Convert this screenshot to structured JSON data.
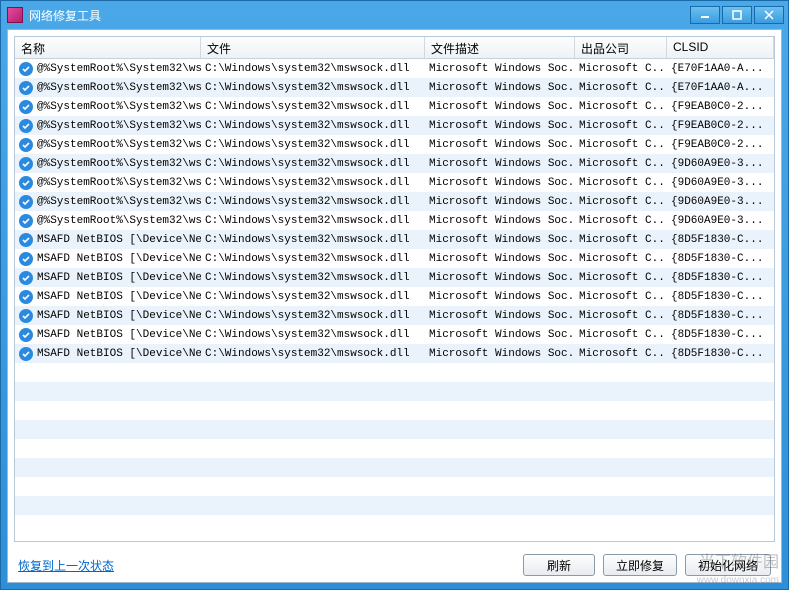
{
  "window": {
    "title": "网络修复工具"
  },
  "columns": {
    "name": "名称",
    "file": "文件",
    "desc": "文件描述",
    "company": "出品公司",
    "clsid": "CLSID"
  },
  "rows": [
    {
      "name": "@%SystemRoot%\\System32\\ws...",
      "file": "C:\\Windows\\system32\\mswsock.dll",
      "desc": "Microsoft Windows Soc...",
      "company": "Microsoft C...",
      "clsid": "{E70F1AA0-A..."
    },
    {
      "name": "@%SystemRoot%\\System32\\ws...",
      "file": "C:\\Windows\\system32\\mswsock.dll",
      "desc": "Microsoft Windows Soc...",
      "company": "Microsoft C...",
      "clsid": "{E70F1AA0-A..."
    },
    {
      "name": "@%SystemRoot%\\System32\\ws...",
      "file": "C:\\Windows\\system32\\mswsock.dll",
      "desc": "Microsoft Windows Soc...",
      "company": "Microsoft C...",
      "clsid": "{F9EAB0C0-2..."
    },
    {
      "name": "@%SystemRoot%\\System32\\ws...",
      "file": "C:\\Windows\\system32\\mswsock.dll",
      "desc": "Microsoft Windows Soc...",
      "company": "Microsoft C...",
      "clsid": "{F9EAB0C0-2..."
    },
    {
      "name": "@%SystemRoot%\\System32\\ws...",
      "file": "C:\\Windows\\system32\\mswsock.dll",
      "desc": "Microsoft Windows Soc...",
      "company": "Microsoft C...",
      "clsid": "{F9EAB0C0-2..."
    },
    {
      "name": "@%SystemRoot%\\System32\\ws...",
      "file": "C:\\Windows\\system32\\mswsock.dll",
      "desc": "Microsoft Windows Soc...",
      "company": "Microsoft C...",
      "clsid": "{9D60A9E0-3..."
    },
    {
      "name": "@%SystemRoot%\\System32\\ws...",
      "file": "C:\\Windows\\system32\\mswsock.dll",
      "desc": "Microsoft Windows Soc...",
      "company": "Microsoft C...",
      "clsid": "{9D60A9E0-3..."
    },
    {
      "name": "@%SystemRoot%\\System32\\ws...",
      "file": "C:\\Windows\\system32\\mswsock.dll",
      "desc": "Microsoft Windows Soc...",
      "company": "Microsoft C...",
      "clsid": "{9D60A9E0-3..."
    },
    {
      "name": "@%SystemRoot%\\System32\\ws...",
      "file": "C:\\Windows\\system32\\mswsock.dll",
      "desc": "Microsoft Windows Soc...",
      "company": "Microsoft C...",
      "clsid": "{9D60A9E0-3..."
    },
    {
      "name": "MSAFD NetBIOS [\\Device\\Ne...",
      "file": "C:\\Windows\\system32\\mswsock.dll",
      "desc": "Microsoft Windows Soc...",
      "company": "Microsoft C...",
      "clsid": "{8D5F1830-C..."
    },
    {
      "name": "MSAFD NetBIOS [\\Device\\Ne...",
      "file": "C:\\Windows\\system32\\mswsock.dll",
      "desc": "Microsoft Windows Soc...",
      "company": "Microsoft C...",
      "clsid": "{8D5F1830-C..."
    },
    {
      "name": "MSAFD NetBIOS [\\Device\\Ne...",
      "file": "C:\\Windows\\system32\\mswsock.dll",
      "desc": "Microsoft Windows Soc...",
      "company": "Microsoft C...",
      "clsid": "{8D5F1830-C..."
    },
    {
      "name": "MSAFD NetBIOS [\\Device\\Ne...",
      "file": "C:\\Windows\\system32\\mswsock.dll",
      "desc": "Microsoft Windows Soc...",
      "company": "Microsoft C...",
      "clsid": "{8D5F1830-C..."
    },
    {
      "name": "MSAFD NetBIOS [\\Device\\Ne...",
      "file": "C:\\Windows\\system32\\mswsock.dll",
      "desc": "Microsoft Windows Soc...",
      "company": "Microsoft C...",
      "clsid": "{8D5F1830-C..."
    },
    {
      "name": "MSAFD NetBIOS [\\Device\\Ne...",
      "file": "C:\\Windows\\system32\\mswsock.dll",
      "desc": "Microsoft Windows Soc...",
      "company": "Microsoft C...",
      "clsid": "{8D5F1830-C..."
    },
    {
      "name": "MSAFD NetBIOS [\\Device\\Ne...",
      "file": "C:\\Windows\\system32\\mswsock.dll",
      "desc": "Microsoft Windows Soc...",
      "company": "Microsoft C...",
      "clsid": "{8D5F1830-C..."
    }
  ],
  "emptyRows": 8,
  "footer": {
    "restoreLink": "恢复到上一次状态",
    "refresh": "刷新",
    "repairNow": "立即修复",
    "initNetwork": "初始化网络"
  },
  "watermark": {
    "main": "当下软件园",
    "sub": "www.downxia.com"
  }
}
